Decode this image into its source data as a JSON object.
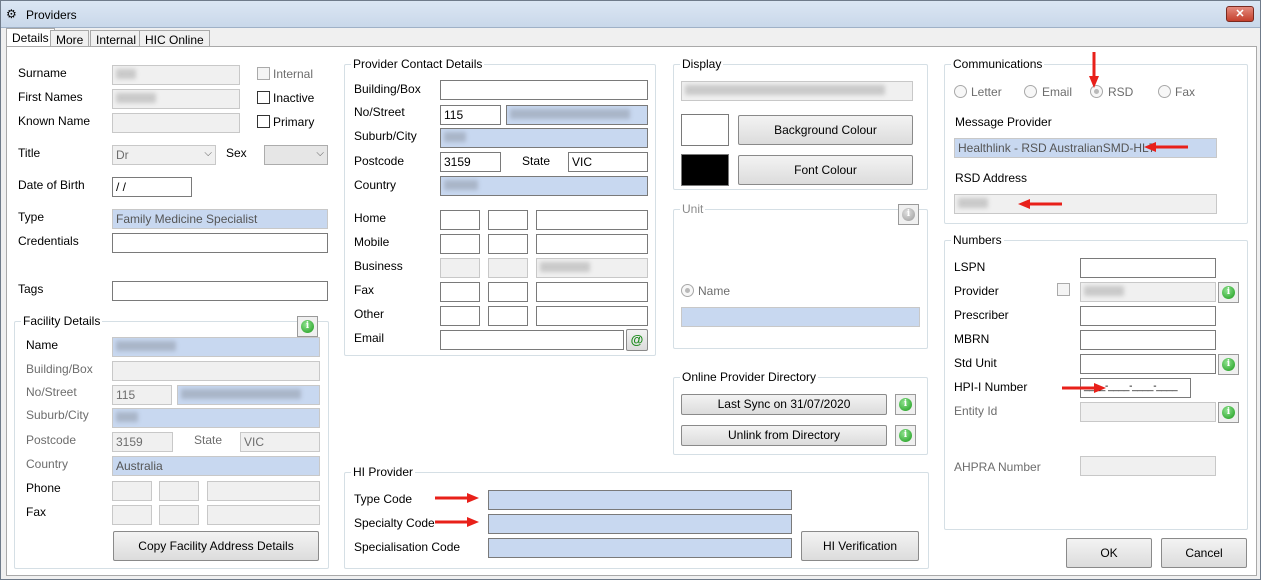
{
  "window": {
    "title": "Providers",
    "close_label": "✕"
  },
  "tabs": [
    "Details",
    "More",
    "Internal",
    "HIC Online"
  ],
  "personal": {
    "surname_label": "Surname",
    "first_names_label": "First Names",
    "known_name_label": "Known Name",
    "title_label": "Title",
    "title_value": "Dr",
    "sex_label": "Sex",
    "dob_label": "Date of Birth",
    "dob_value": " /  /",
    "type_label": "Type",
    "type_value": "Family Medicine Specialist",
    "credentials_label": "Credentials",
    "tags_label": "Tags",
    "internal_label": "Internal",
    "inactive_label": "Inactive",
    "primary_label": "Primary"
  },
  "facility": {
    "group_title": "Facility Details",
    "name_label": "Name",
    "building_label": "Building/Box",
    "street_label": "No/Street",
    "street_no": "115",
    "suburb_label": "Suburb/City",
    "postcode_label": "Postcode",
    "postcode_value": "3159",
    "state_label": "State",
    "state_value": "VIC",
    "country_label": "Country",
    "country_value": "Australia",
    "phone_label": "Phone",
    "fax_label": "Fax",
    "copy_button": "Copy Facility Address Details"
  },
  "contact": {
    "group_title": "Provider Contact Details",
    "building_label": "Building/Box",
    "street_label": "No/Street",
    "street_no": "115",
    "suburb_label": "Suburb/City",
    "postcode_label": "Postcode",
    "postcode_value": "3159",
    "state_label": "State",
    "state_value": "VIC",
    "country_label": "Country",
    "home_label": "Home",
    "mobile_label": "Mobile",
    "business_label": "Business",
    "fax_label": "Fax",
    "other_label": "Other",
    "email_label": "Email",
    "email_button": "@"
  },
  "hi_provider": {
    "group_title": "HI Provider",
    "type_code_label": "Type Code",
    "specialty_code_label": "Specialty Code",
    "specialisation_code_label": "Specialisation Code",
    "verify_button": "HI Verification"
  },
  "display": {
    "group_title": "Display",
    "background_button": "Background Colour",
    "font_button": "Font Colour",
    "background_color": "#ffffff",
    "font_color": "#000000"
  },
  "unit": {
    "group_title": "Unit",
    "name_label": "Name"
  },
  "directory": {
    "group_title": "Online Provider Directory",
    "sync_button": "Last Sync on 31/07/2020",
    "unlink_button": "Unlink from Directory"
  },
  "communications": {
    "group_title": "Communications",
    "options": [
      "Letter",
      "Email",
      "RSD",
      "Fax"
    ],
    "selected": "RSD",
    "message_provider_label": "Message Provider",
    "message_provider_value": "Healthlink - RSD AustralianSMD-HL7",
    "rsd_address_label": "RSD Address"
  },
  "numbers": {
    "group_title": "Numbers",
    "lspn_label": "LSPN",
    "provider_label": "Provider",
    "prescriber_label": "Prescriber",
    "mbrn_label": "MBRN",
    "std_unit_label": "Std Unit",
    "hpii_label": "HPI-I Number",
    "hpii_mask": "____-____-____-____",
    "entity_id_label": "Entity Id",
    "ahpra_label": "AHPRA Number"
  },
  "footer": {
    "ok_button": "OK",
    "cancel_button": "Cancel"
  },
  "annotation_color": "#e8201a"
}
